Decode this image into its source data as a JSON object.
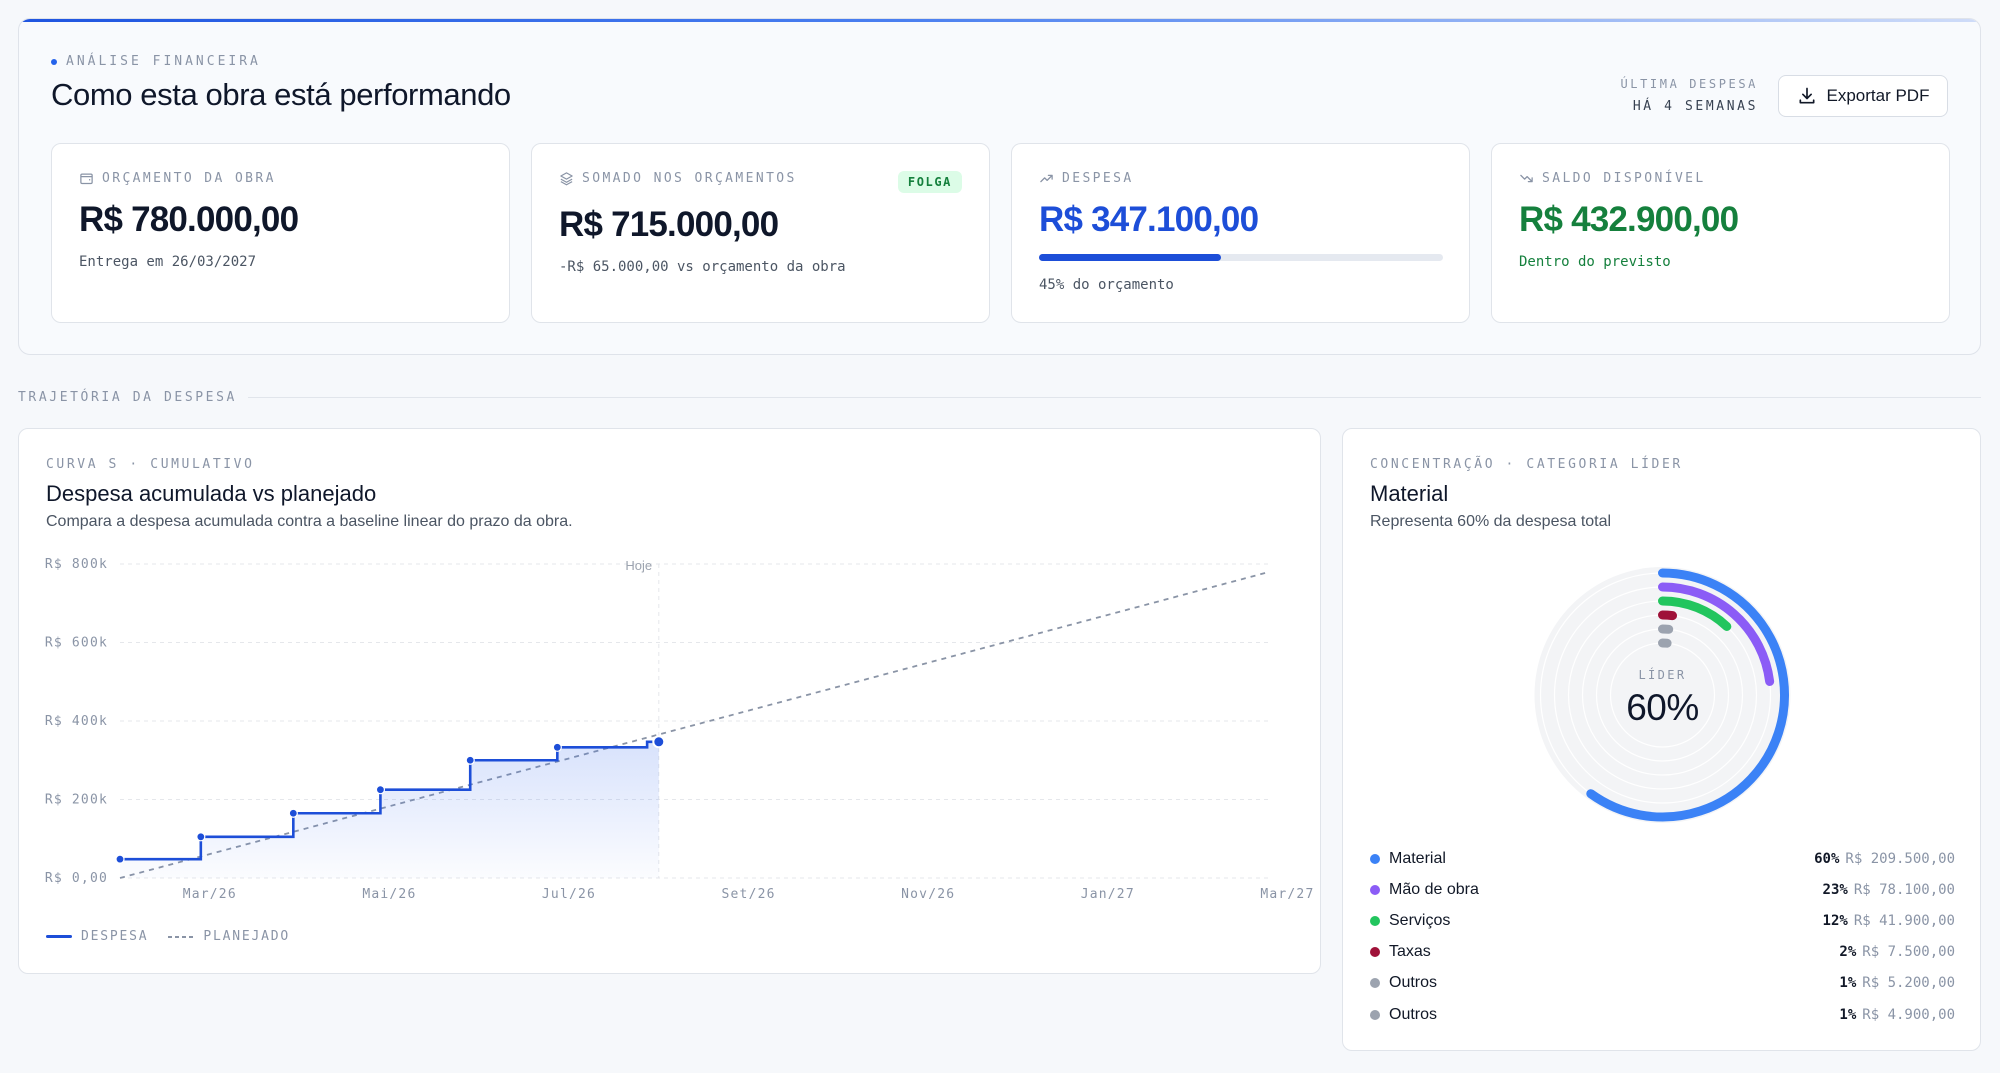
{
  "header": {
    "eyebrow": "ANÁLISE FINANCEIRA",
    "title": "Como esta obra está performando",
    "last_expense_label": "ÚLTIMA DESPESA",
    "last_expense_value": "HÁ 4 SEMANAS",
    "export_label": "Exportar PDF"
  },
  "kpis": [
    {
      "label": "ORÇAMENTO DA OBRA",
      "icon": "wallet-icon",
      "value": "R$ 780.000,00",
      "sub": "Entrega em 26/03/2027",
      "value_color": "#0f172a",
      "sub_color": "#4b5563"
    },
    {
      "label": "SOMADO NOS ORÇAMENTOS",
      "icon": "layers-icon",
      "value": "R$ 715.000,00",
      "sub": "-R$ 65.000,00 vs orçamento da obra",
      "badge": "FOLGA",
      "value_color": "#0f172a",
      "sub_color": "#4b5563"
    },
    {
      "label": "DESPESA",
      "icon": "trending-up-icon",
      "value": "R$ 347.100,00",
      "sub": "45% do orçamento",
      "progress": 0.45,
      "value_color": "#1d4ed8",
      "sub_color": "#4b5563"
    },
    {
      "label": "SALDO DISPONÍVEL",
      "icon": "trending-down-icon",
      "value": "R$ 432.900,00",
      "sub": "Dentro do previsto",
      "value_color": "#15803d",
      "sub_color": "#15803d"
    }
  ],
  "section": {
    "label": "TRAJETÓRIA DA DESPESA"
  },
  "chart_card": {
    "eyebrow": "CURVA S · CUMULATIVO",
    "title": "Despesa acumulada vs planejado",
    "description": "Compara a despesa acumulada contra a baseline linear do prazo da obra.",
    "legend": {
      "actual": "DESPESA",
      "planned": "PLANEJADO"
    }
  },
  "chart_data": {
    "type": "line",
    "x_ticks": [
      "Mar/26",
      "Mai/26",
      "Jul/26",
      "Set/26",
      "Nov/26",
      "Jan/27",
      "Mar/27"
    ],
    "y_ticks": [
      "R$ 0,00",
      "R$ 200k",
      "R$ 400k",
      "R$ 600k",
      "R$ 800k"
    ],
    "y_tick_values": [
      0,
      200000,
      400000,
      600000,
      800000
    ],
    "ylim": [
      0,
      800000
    ],
    "today_label": "Hoje",
    "today_month": 6.0,
    "month_note": "x values are months elapsed since Feb/26 (Mar/26 = 1)",
    "series": [
      {
        "name": "DESPESA",
        "style": "step",
        "color": "#1d4ed8",
        "points": [
          [
            0,
            48000
          ],
          [
            0.9,
            105000
          ],
          [
            1.93,
            165000
          ],
          [
            2.9,
            225000
          ],
          [
            3.9,
            300000
          ],
          [
            4.87,
            333000
          ],
          [
            5.87,
            347100
          ],
          [
            6.0,
            347100
          ]
        ]
      },
      {
        "name": "PLANEJADO",
        "style": "dashed",
        "color": "#8a94a6",
        "points": [
          [
            0,
            0
          ],
          [
            12.8,
            780000
          ]
        ]
      }
    ]
  },
  "donut_card": {
    "eyebrow": "CONCENTRAÇÃO · CATEGORIA LÍDER",
    "title": "Material",
    "description": "Representa 60% da despesa total",
    "center_label": "LÍDER",
    "center_value": "60%",
    "categories": [
      {
        "name": "Material",
        "pct": "60%",
        "amount": "R$ 209.500,00",
        "share": 0.6,
        "color": "#3b82f6"
      },
      {
        "name": "Mão de obra",
        "pct": "23%",
        "amount": "R$ 78.100,00",
        "share": 0.23,
        "color": "#8b5cf6"
      },
      {
        "name": "Serviços",
        "pct": "12%",
        "amount": "R$ 41.900,00",
        "share": 0.12,
        "color": "#22c55e"
      },
      {
        "name": "Taxas",
        "pct": "2%",
        "amount": "R$ 7.500,00",
        "share": 0.02,
        "color": "#9f1239"
      },
      {
        "name": "Outros",
        "pct": "1%",
        "amount": "R$ 5.200,00",
        "share": 0.015,
        "color": "#9ca3af"
      },
      {
        "name": "Outros",
        "pct": "1%",
        "amount": "R$ 4.900,00",
        "share": 0.014,
        "color": "#9ca3af"
      }
    ]
  }
}
